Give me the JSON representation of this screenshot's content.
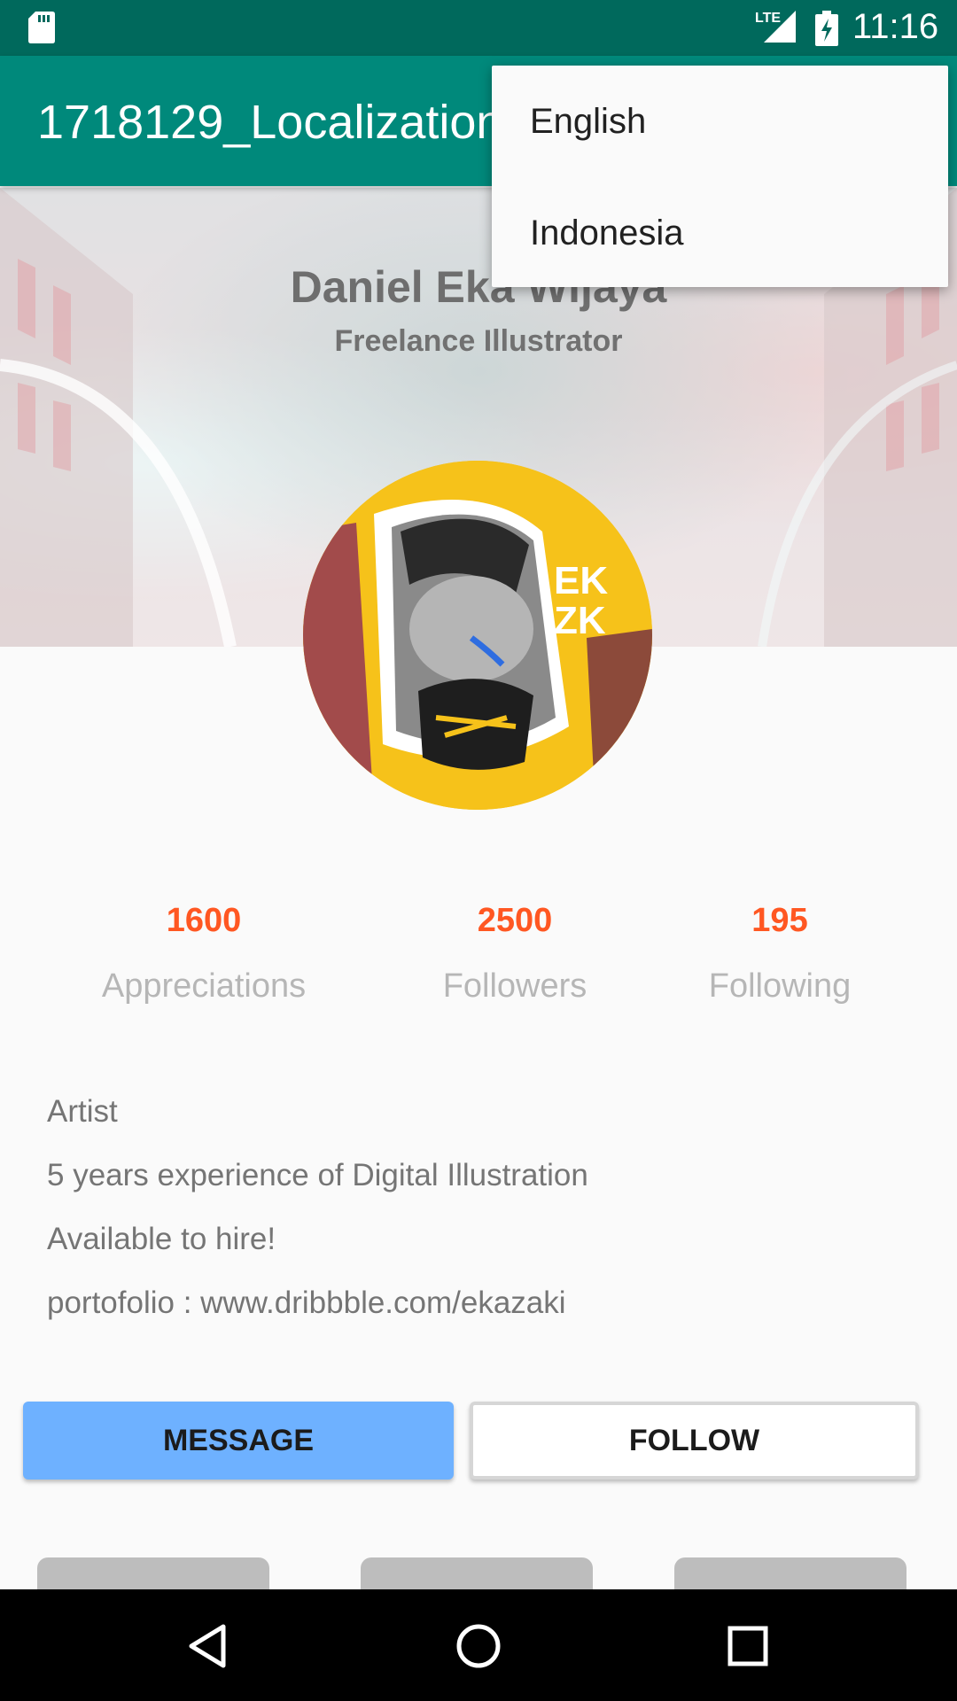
{
  "status_bar": {
    "network": "LTE",
    "time": "11:16"
  },
  "app_bar": {
    "title": "1718129_Localization"
  },
  "menu": {
    "items": [
      "English",
      "Indonesia"
    ]
  },
  "profile": {
    "name": "Daniel Eka Wijaya",
    "subtitle": "Freelance Illustrator"
  },
  "stats": [
    {
      "value": "1600",
      "label": "Appreciations"
    },
    {
      "value": "2500",
      "label": "Followers"
    },
    {
      "value": "195",
      "label": "Following"
    }
  ],
  "bio": [
    "Artist",
    "5 years experience of Digital Illustration",
    "Available to hire!",
    "portofolio : www.dribbble.com/ekazaki"
  ],
  "buttons": {
    "message": "MESSAGE",
    "follow": "FOLLOW"
  },
  "colors": {
    "primary_dark": "#00695c",
    "primary": "#00897b",
    "accent": "#ff5722",
    "message_button": "#6eb1ff"
  },
  "icons": [
    "sd-card-icon",
    "signal-icon",
    "battery-charging-icon",
    "back-icon",
    "home-icon",
    "recents-icon"
  ]
}
